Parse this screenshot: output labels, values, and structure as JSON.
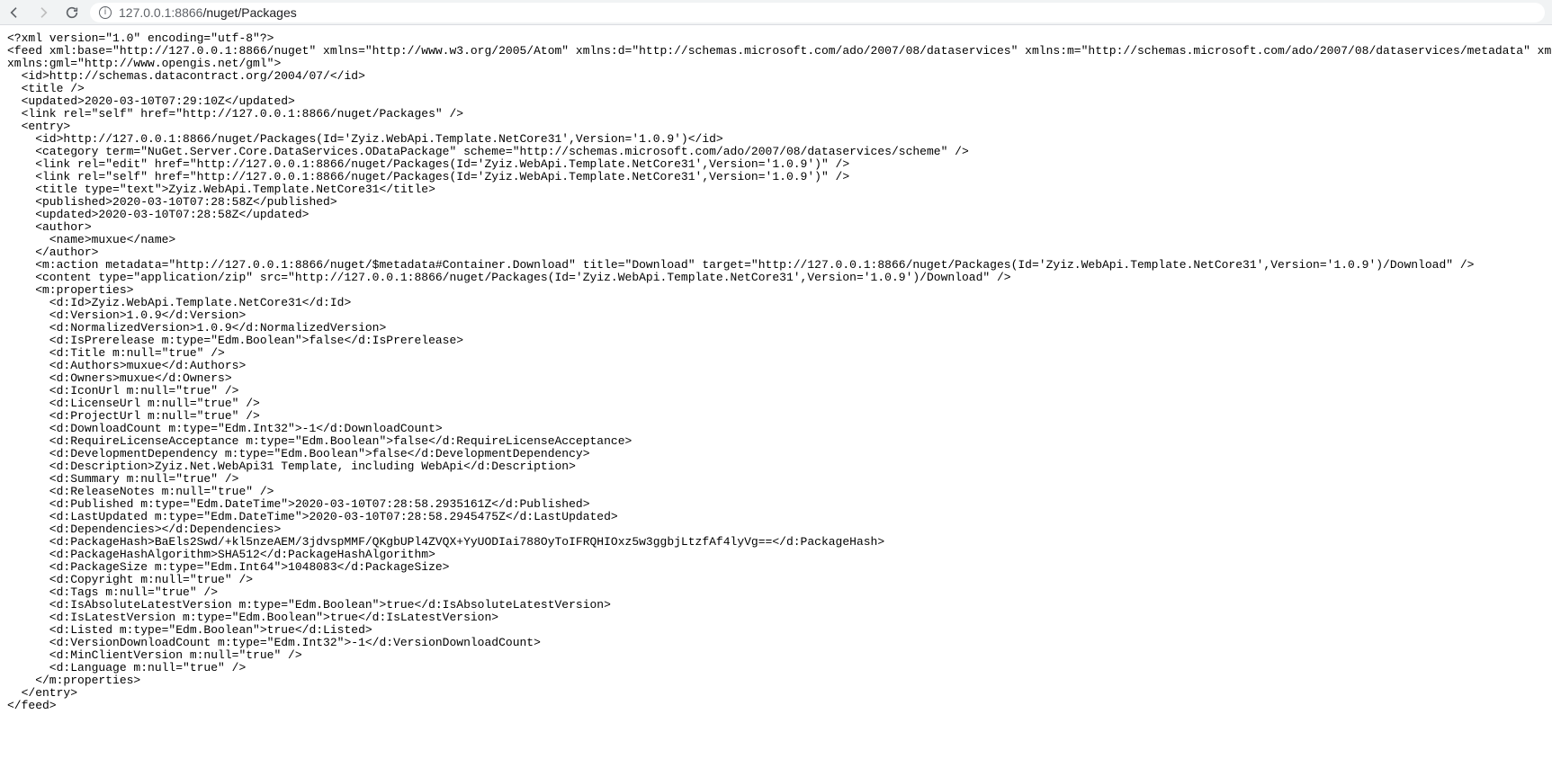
{
  "browser": {
    "url_host": "127.0.0.1",
    "url_port": ":8866",
    "url_path": "/nuget/Packages"
  },
  "xml": {
    "declaration": "<?xml version=\"1.0\" encoding=\"utf-8\"?>",
    "feed_open": "<feed xml:base=\"http://127.0.0.1:8866/nuget\" xmlns=\"http://www.w3.org/2005/Atom\" xmlns:d=\"http://schemas.microsoft.com/ado/2007/08/dataservices\" xmlns:m=\"http://schemas.microsoft.com/ado/2007/08/dataservices/metadata\" xmlns:georss=\"http://www.geo",
    "feed_open2": "xmlns:gml=\"http://www.opengis.net/gml\">",
    "feed_id": "  <id>http://schemas.datacontract.org/2004/07/</id>",
    "feed_title": "  <title />",
    "feed_updated": "  <updated>2020-03-10T07:29:10Z</updated>",
    "feed_link": "  <link rel=\"self\" href=\"http://127.0.0.1:8866/nuget/Packages\" />",
    "entry_open": "  <entry>",
    "entry_id": "    <id>http://127.0.0.1:8866/nuget/Packages(Id='Zyiz.WebApi.Template.NetCore31',Version='1.0.9')</id>",
    "entry_category": "    <category term=\"NuGet.Server.Core.DataServices.ODataPackage\" scheme=\"http://schemas.microsoft.com/ado/2007/08/dataservices/scheme\" />",
    "entry_link_edit": "    <link rel=\"edit\" href=\"http://127.0.0.1:8866/nuget/Packages(Id='Zyiz.WebApi.Template.NetCore31',Version='1.0.9')\" />",
    "entry_link_self": "    <link rel=\"self\" href=\"http://127.0.0.1:8866/nuget/Packages(Id='Zyiz.WebApi.Template.NetCore31',Version='1.0.9')\" />",
    "entry_title": "    <title type=\"text\">Zyiz.WebApi.Template.NetCore31</title>",
    "entry_published": "    <published>2020-03-10T07:28:58Z</published>",
    "entry_updated": "    <updated>2020-03-10T07:28:58Z</updated>",
    "author_open": "    <author>",
    "author_name": "      <name>muxue</name>",
    "author_close": "    </author>",
    "m_action": "    <m:action metadata=\"http://127.0.0.1:8866/nuget/$metadata#Container.Download\" title=\"Download\" target=\"http://127.0.0.1:8866/nuget/Packages(Id='Zyiz.WebApi.Template.NetCore31',Version='1.0.9')/Download\" />",
    "m_content": "    <content type=\"application/zip\" src=\"http://127.0.0.1:8866/nuget/Packages(Id='Zyiz.WebApi.Template.NetCore31',Version='1.0.9')/Download\" />",
    "props_open": "    <m:properties>",
    "p_id": "      <d:Id>Zyiz.WebApi.Template.NetCore31</d:Id>",
    "p_version": "      <d:Version>1.0.9</d:Version>",
    "p_normversion": "      <d:NormalizedVersion>1.0.9</d:NormalizedVersion>",
    "p_isprerelease": "      <d:IsPrerelease m:type=\"Edm.Boolean\">false</d:IsPrerelease>",
    "p_title": "      <d:Title m:null=\"true\" />",
    "p_authors": "      <d:Authors>muxue</d:Authors>",
    "p_owners": "      <d:Owners>muxue</d:Owners>",
    "p_iconurl": "      <d:IconUrl m:null=\"true\" />",
    "p_licenseurl": "      <d:LicenseUrl m:null=\"true\" />",
    "p_projecturl": "      <d:ProjectUrl m:null=\"true\" />",
    "p_downloadcount": "      <d:DownloadCount m:type=\"Edm.Int32\">-1</d:DownloadCount>",
    "p_reqlicense": "      <d:RequireLicenseAcceptance m:type=\"Edm.Boolean\">false</d:RequireLicenseAcceptance>",
    "p_devdep": "      <d:DevelopmentDependency m:type=\"Edm.Boolean\">false</d:DevelopmentDependency>",
    "p_description": "      <d:Description>Zyiz.Net.WebApi31 Template, including WebApi</d:Description>",
    "p_summary": "      <d:Summary m:null=\"true\" />",
    "p_releasenotes": "      <d:ReleaseNotes m:null=\"true\" />",
    "p_published": "      <d:Published m:type=\"Edm.DateTime\">2020-03-10T07:28:58.2935161Z</d:Published>",
    "p_lastupdated": "      <d:LastUpdated m:type=\"Edm.DateTime\">2020-03-10T07:28:58.2945475Z</d:LastUpdated>",
    "p_dependencies": "      <d:Dependencies></d:Dependencies>",
    "p_packagehash": "      <d:PackageHash>BaEls2Swd/+kl5nzeAEM/3jdvspMMF/QKgbUPl4ZVQX+YyUODIai788OyToIFRQHIOxz5w3ggbjLtzfAf4lyVg==</d:PackageHash>",
    "p_hashalgo": "      <d:PackageHashAlgorithm>SHA512</d:PackageHashAlgorithm>",
    "p_packagesize": "      <d:PackageSize m:type=\"Edm.Int64\">1048083</d:PackageSize>",
    "p_copyright": "      <d:Copyright m:null=\"true\" />",
    "p_tags": "      <d:Tags m:null=\"true\" />",
    "p_isabslatest": "      <d:IsAbsoluteLatestVersion m:type=\"Edm.Boolean\">true</d:IsAbsoluteLatestVersion>",
    "p_islatest": "      <d:IsLatestVersion m:type=\"Edm.Boolean\">true</d:IsLatestVersion>",
    "p_listed": "      <d:Listed m:type=\"Edm.Boolean\">true</d:Listed>",
    "p_versiondlcount": "      <d:VersionDownloadCount m:type=\"Edm.Int32\">-1</d:VersionDownloadCount>",
    "p_minclient": "      <d:MinClientVersion m:null=\"true\" />",
    "p_language": "      <d:Language m:null=\"true\" />",
    "props_close": "    </m:properties>",
    "entry_close": "  </entry>",
    "feed_close": "</feed>"
  }
}
